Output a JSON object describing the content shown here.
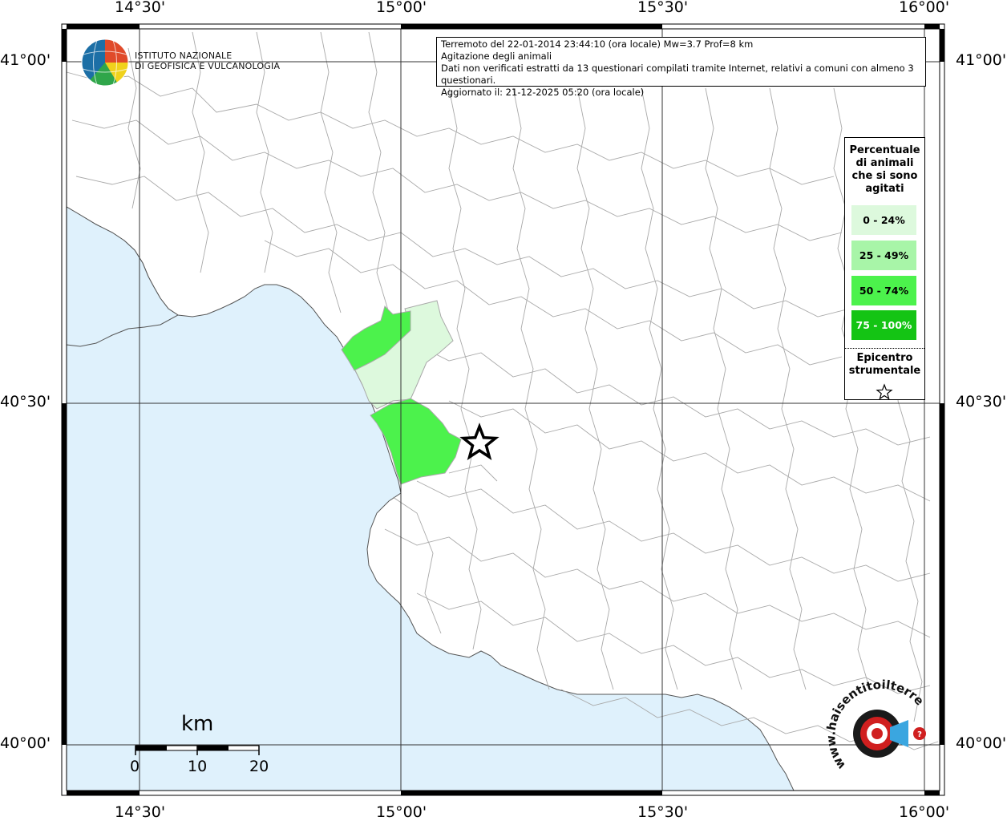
{
  "header": {
    "line1": "Terremoto del 22-01-2014 23:44:10 (ora locale) Mw=3.7 Prof=8 km",
    "line2": "Agitazione degli animali",
    "line3": "Dati non verificati estratti da 13 questionari compilati tramite Internet, relativi a comuni con almeno 3 questionari.",
    "line4": "Aggiornato il: 21-12-2025 05:20 (ora locale)"
  },
  "logo": {
    "line1": "ISTITUTO NAZIONALE",
    "line2": "DI GEOFISICA E VULCANOLOGIA"
  },
  "axes": {
    "top": [
      "14°30'",
      "15°00'",
      "15°30'",
      "16°00'"
    ],
    "bottom": [
      "14°30'",
      "15°00'",
      "15°30'",
      "16°00'"
    ],
    "left": [
      "41°00'",
      "40°30'",
      "40°00'"
    ],
    "right": [
      "41°00'",
      "40°30'",
      "40°00'"
    ]
  },
  "legend": {
    "title": "Percentuale di animali che si sono agitati",
    "items": [
      {
        "label": "0 - 24%",
        "color": "#ddf9dd"
      },
      {
        "label": "25 - 49%",
        "color": "#a8f5a8"
      },
      {
        "label": "50 - 74%",
        "color": "#4cf24c"
      },
      {
        "label": "75 - 100%",
        "color": "#14c414"
      }
    ],
    "epicenter_label": "Epicentro strumentale"
  },
  "scale": {
    "unit": "km",
    "ticks": [
      "0",
      "10",
      "20"
    ]
  },
  "watermark": {
    "text": "www.haisentitoilterremoto.it"
  },
  "colors": {
    "sea": "#dff1fc",
    "land": "#ffffff",
    "borders": "#a9a9a9",
    "grid": "#333333"
  }
}
